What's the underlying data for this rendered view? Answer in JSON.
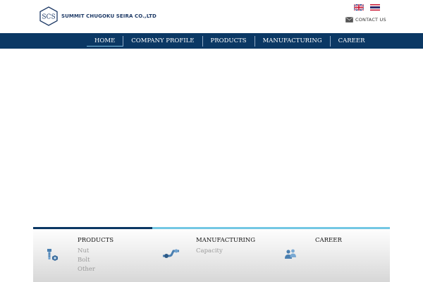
{
  "header": {
    "logo_mark": "SCS",
    "company_name": "SUMMIT CHUGOKU SEIRA CO.,LTD",
    "contact_label": "CONTACT US",
    "icons": {
      "flag_en": "uk-flag-icon",
      "flag_th": "thai-flag-icon",
      "mail": "mail-icon"
    }
  },
  "nav": {
    "items": [
      {
        "label": "HOME",
        "active": true
      },
      {
        "label": "COMPANY PROFILE"
      },
      {
        "label": "PRODUCTS"
      },
      {
        "label": "MANUFACTURING"
      },
      {
        "label": "CAREER"
      }
    ]
  },
  "footer_sections": {
    "products": {
      "title": "PRODUCTS",
      "icon": "bolt-nut-icon",
      "links": [
        "Nut",
        "Bolt",
        "Other"
      ]
    },
    "manufacturing": {
      "title": "MANUFACTURING",
      "icon": "pipe-valve-icon",
      "links": [
        "Capacity"
      ]
    },
    "career": {
      "title": "CAREER",
      "icon": "people-icon",
      "links": []
    }
  },
  "colors": {
    "nav_bg": "#0b3864",
    "accent_light": "#73c7e4",
    "logo_blue": "#1e3a66",
    "link_gray": "#9a9a9a"
  }
}
